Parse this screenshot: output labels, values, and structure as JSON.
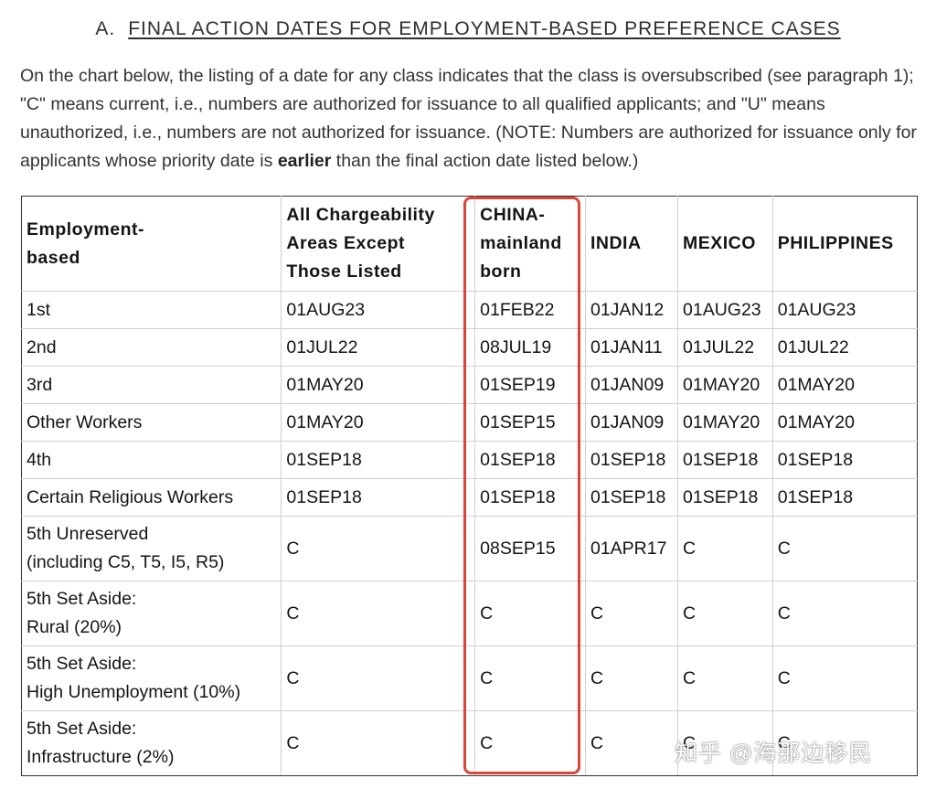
{
  "section": {
    "letter": "A.",
    "title": "FINAL ACTION DATES FOR EMPLOYMENT-BASED PREFERENCE CASES"
  },
  "intro": {
    "part1": "On the chart below, the listing of a date for any class indicates that the class is oversubscribed (see paragraph 1); \"C\" means current, i.e., numbers are authorized for issuance to all qualified applicants; and \"U\" means unauthorized, i.e., numbers are not authorized for issuance. (NOTE: Numbers are authorized for issuance only for applicants whose priority date is ",
    "bold": "earlier",
    "part2": " than the final action date listed below.)"
  },
  "table": {
    "headers": [
      "Employment-\nbased",
      "All Chargeability\nAreas Except\nThose Listed",
      "CHINA-\nmainland\nborn",
      "INDIA",
      "MEXICO",
      "PHILIPPINES"
    ],
    "rows": [
      [
        "1st",
        "01AUG23",
        "01FEB22",
        "01JAN12",
        "01AUG23",
        "01AUG23"
      ],
      [
        "2nd",
        "01JUL22",
        "08JUL19",
        "01JAN11",
        "01JUL22",
        "01JUL22"
      ],
      [
        "3rd",
        "01MAY20",
        "01SEP19",
        "01JAN09",
        "01MAY20",
        "01MAY20"
      ],
      [
        "Other Workers",
        "01MAY20",
        "01SEP15",
        "01JAN09",
        "01MAY20",
        "01MAY20"
      ],
      [
        "4th",
        "01SEP18",
        "01SEP18",
        "01SEP18",
        "01SEP18",
        "01SEP18"
      ],
      [
        "Certain Religious Workers",
        "01SEP18",
        "01SEP18",
        "01SEP18",
        "01SEP18",
        "01SEP18"
      ],
      [
        "5th Unreserved\n(including C5, T5, I5, R5)",
        "C",
        "08SEP15",
        "01APR17",
        "C",
        "C"
      ],
      [
        "5th Set Aside:\nRural (20%)",
        "C",
        "C",
        "C",
        "C",
        "C"
      ],
      [
        "5th Set Aside:\nHigh Unemployment (10%)",
        "C",
        "C",
        "C",
        "C",
        "C"
      ],
      [
        "5th Set Aside:\nInfrastructure (2%)",
        "C",
        "C",
        "C",
        "C",
        "C"
      ]
    ]
  },
  "highlight_color": "#d9463b",
  "watermark": "知乎 @海那边移民"
}
